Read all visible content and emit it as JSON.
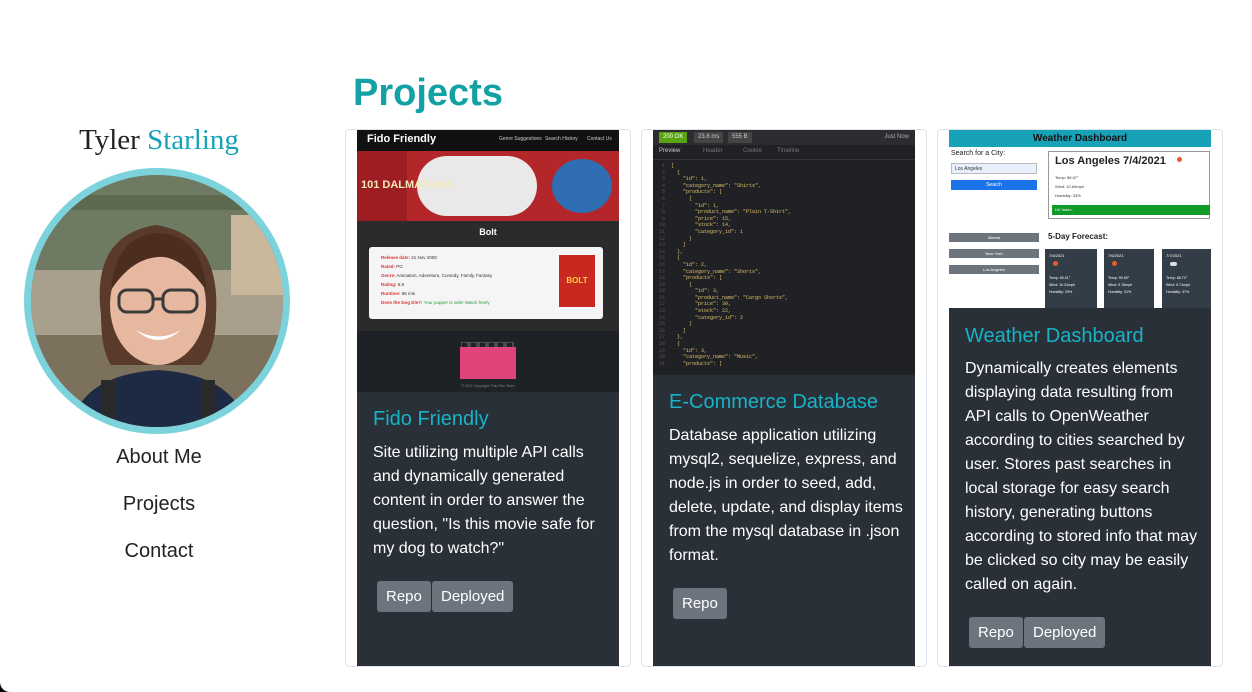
{
  "sidebar": {
    "first_name": "Tyler",
    "last_name": "Starling",
    "nav": [
      "About Me",
      "Projects",
      "Contact"
    ]
  },
  "main": {
    "heading": "Projects",
    "projects": [
      {
        "title": "Fido Friendly",
        "description": "Site utilizing multiple API calls and dynamically generated content in order to answer the question, \"Is this movie safe for my dog to watch?\"",
        "buttons": [
          "Repo",
          "Deployed"
        ],
        "preview": {
          "logo": "Fido Friendly",
          "nav_items": [
            "Genre Suggestions",
            "Search History",
            "Contact Us"
          ],
          "movie_title": "Bolt",
          "hero_text": "101 DALMATIANS",
          "fields": [
            {
              "label": "Release date:",
              "value": "21 Nov 2008"
            },
            {
              "label": "Rated:",
              "value": "PG"
            },
            {
              "label": "Genre:",
              "value": "Animation, Adventure, Comedy, Family, Fantasy"
            },
            {
              "label": "Rating:",
              "value": "6.8"
            },
            {
              "label": "Runtime:",
              "value": "96 min"
            },
            {
              "label": "Does the Dog Die?:",
              "value": "Your pupper is safe! Watch freely"
            }
          ],
          "poster_text": "BOLT",
          "footer": "© 2021 Copyright: Fido Film Team"
        }
      },
      {
        "title": "E-Commerce Database",
        "description": "Database application utilizing mysql2, sequelize, express, and node.js in order to seed, add, delete, update, and display items from the mysql database in .json format.",
        "buttons": [
          "Repo"
        ],
        "preview": {
          "status": "200 OK",
          "time": "23.6 ms",
          "size": "555 B",
          "when": "Just Now",
          "tabs": [
            "Preview",
            "Header",
            "Cookie",
            "Timeline"
          ],
          "code": [
            "[",
            "  {",
            "    \"id\": 1,",
            "    \"category_name\": \"Shirts\",",
            "    \"products\": [",
            "      {",
            "        \"id\": 1,",
            "        \"product_name\": \"Plain T-Shirt\",",
            "        \"price\": 15,",
            "        \"stock\": 14,",
            "        \"category_id\": 1",
            "      }",
            "    ]",
            "  },",
            "  {",
            "    \"id\": 2,",
            "    \"category_name\": \"Shorts\",",
            "    \"products\": [",
            "      {",
            "        \"id\": 3,",
            "        \"product_name\": \"Cargo Shorts\",",
            "        \"price\": 30,",
            "        \"stock\": 22,",
            "        \"category_id\": 2",
            "      }",
            "    ]",
            "  },",
            "  {",
            "    \"id\": 3,",
            "    \"category_name\": \"Music\",",
            "    \"products\": ["
          ]
        }
      },
      {
        "title": "Weather Dashboard",
        "description": "Dynamically creates elements displaying data resulting from API calls to OpenWeather according to cities searched by user. Stores past searches in local storage for easy search history, generating buttons according to stored info that may be clicked so city may be easily called on again.",
        "buttons": [
          "Repo",
          "Deployed"
        ],
        "preview": {
          "header": "Weather Dashboard",
          "search_label": "Search for a City:",
          "search_value": "Los Angeles",
          "search_button": "Search",
          "current_title": "Los Angeles 7/4/2021",
          "current_lines": [
            "Temp: 86.67°",
            "Wind: 10.84mph",
            "Humidity: 33%"
          ],
          "uv_label": "UV Index:",
          "history": [
            "Atlanta",
            "New York",
            "Los Angeles"
          ],
          "forecast_label": "5-Day Forecast:",
          "forecast": [
            {
              "date": "7/5/2021",
              "temp": "Temp: 89.01°",
              "wind": "Wind: 10.31mph",
              "humidity": "Humidity: 29%"
            },
            {
              "date": "7/6/2021",
              "temp": "Temp: 90.59°",
              "wind": "Wind: 9.78mph",
              "humidity": "Humidity: 31%"
            },
            {
              "date": "7/7/2021",
              "temp": "Temp: 88.72°",
              "wind": "Wind: 9.71mph",
              "humidity": "Humidity: 37%"
            }
          ]
        }
      }
    ]
  },
  "colors": {
    "accent": "#13a1a5",
    "card_bg": "#2a3038",
    "card_title": "#17b3c6",
    "button_bg": "#6c757d"
  }
}
